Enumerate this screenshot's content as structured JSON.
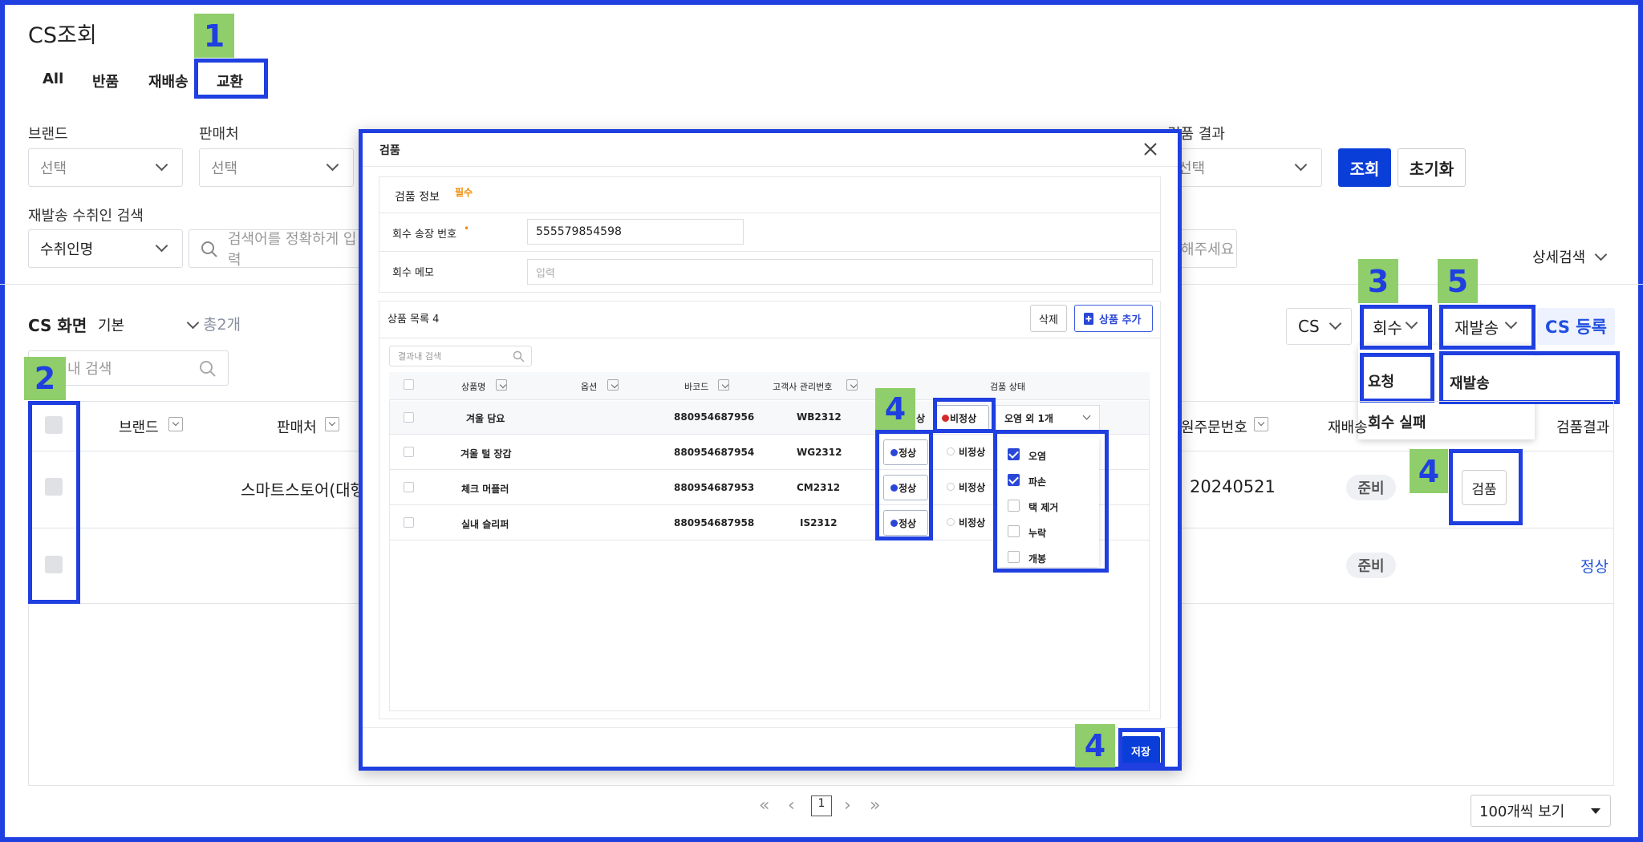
{
  "page": {
    "title": "CS조회",
    "tabs": [
      "All",
      "반품",
      "재배송",
      "교환"
    ],
    "filters": {
      "brand_label": "브랜드",
      "brand_value": "선택",
      "seller_label": "판매처",
      "seller_value": "선택",
      "inspection_result_label": "검품 결과",
      "inspection_result_value": "선택",
      "search_button": "조회",
      "reset_button": "초기화",
      "recipient_search_label": "재발송 수취인 검색",
      "recipient_type": "수취인명",
      "search_placeholder": "검색어를 정확하게 입력",
      "search_placeholder_tail": "해주세요",
      "detail_search": "상세검색"
    },
    "list": {
      "label": "CS 화면",
      "view": "기본",
      "total": "총2개",
      "result_search_placeholder": "내 검색",
      "cs_select": "CS",
      "collect_select": "회수",
      "resend_select": "재발송",
      "register_button": "CS 등록",
      "collect_menu": [
        "요청",
        "회수 실패"
      ],
      "resend_menu": [
        "재발송"
      ],
      "columns": {
        "brand": "브랜드",
        "seller": "판매처",
        "orig_order_no": "원주문번호",
        "resend": "재배송",
        "inspect_result": "검품결과"
      },
      "rows": [
        {
          "seller": "스마트스토어(대행",
          "orig_order_no": "20240521",
          "resend_status": "준비",
          "action": "검품"
        },
        {
          "resend_status": "준비",
          "inspect_result": "정상"
        }
      ],
      "pagination": {
        "current": "1"
      },
      "page_size": "100개씩 보기"
    }
  },
  "modal": {
    "title": "검품",
    "section_title": "검품 정보",
    "required": "필수",
    "tracking_label": "회수 송장 번호",
    "tracking_value": "555579854598",
    "memo_label": "회수 메모",
    "memo_placeholder": "입력",
    "product_list_label": "상품 목록 4",
    "delete_button": "삭제",
    "add_button": "상품 추가",
    "result_search_placeholder": "결과내 검색",
    "columns": {
      "name": "상품명",
      "option": "옵션",
      "barcode": "바코드",
      "client_no": "고객사 관리번호",
      "status": "검품 상태"
    },
    "rows": [
      {
        "name": "겨울 담요",
        "barcode": "880954687956",
        "client_no": "WB2312",
        "status": "비정상"
      },
      {
        "name": "겨울 털 장갑",
        "barcode": "880954687954",
        "client_no": "WG2312",
        "status": "정상"
      },
      {
        "name": "체크 머플러",
        "barcode": "880954687953",
        "client_no": "CM2312",
        "status": "정상"
      },
      {
        "name": "실내 슬리퍼",
        "barcode": "880954687958",
        "client_no": "IS2312",
        "status": "정상"
      }
    ],
    "normal_label": "정상",
    "abnormal_label": "비정상",
    "row1_partial": "상",
    "defect_select": "오염 외 1개",
    "defect_options": [
      {
        "label": "오염",
        "checked": true
      },
      {
        "label": "파손",
        "checked": true
      },
      {
        "label": "택 제거",
        "checked": false
      },
      {
        "label": "누락",
        "checked": false
      },
      {
        "label": "개봉",
        "checked": false
      }
    ],
    "save_button": "저장"
  },
  "annotations": [
    "1",
    "2",
    "3",
    "4",
    "5"
  ],
  "colors": {
    "primary": "#0a3ed8",
    "highlight": "#1f3fe0",
    "badge": "#8fce6a",
    "abnormal": "#d62a2a"
  }
}
